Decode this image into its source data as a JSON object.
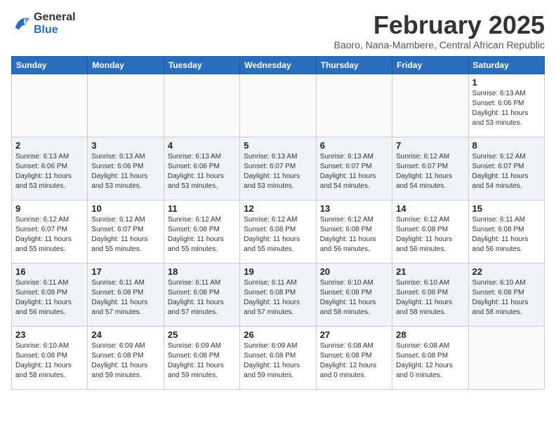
{
  "header": {
    "logo_line1": "General",
    "logo_line2": "Blue",
    "month_title": "February 2025",
    "subtitle": "Baoro, Nana-Mambere, Central African Republic"
  },
  "weekdays": [
    "Sunday",
    "Monday",
    "Tuesday",
    "Wednesday",
    "Thursday",
    "Friday",
    "Saturday"
  ],
  "weeks": [
    [
      {
        "day": "",
        "info": ""
      },
      {
        "day": "",
        "info": ""
      },
      {
        "day": "",
        "info": ""
      },
      {
        "day": "",
        "info": ""
      },
      {
        "day": "",
        "info": ""
      },
      {
        "day": "",
        "info": ""
      },
      {
        "day": "1",
        "info": "Sunrise: 6:13 AM\nSunset: 6:06 PM\nDaylight: 11 hours\nand 53 minutes."
      }
    ],
    [
      {
        "day": "2",
        "info": "Sunrise: 6:13 AM\nSunset: 6:06 PM\nDaylight: 11 hours\nand 53 minutes."
      },
      {
        "day": "3",
        "info": "Sunrise: 6:13 AM\nSunset: 6:06 PM\nDaylight: 11 hours\nand 53 minutes."
      },
      {
        "day": "4",
        "info": "Sunrise: 6:13 AM\nSunset: 6:06 PM\nDaylight: 11 hours\nand 53 minutes."
      },
      {
        "day": "5",
        "info": "Sunrise: 6:13 AM\nSunset: 6:07 PM\nDaylight: 11 hours\nand 53 minutes."
      },
      {
        "day": "6",
        "info": "Sunrise: 6:13 AM\nSunset: 6:07 PM\nDaylight: 11 hours\nand 54 minutes."
      },
      {
        "day": "7",
        "info": "Sunrise: 6:12 AM\nSunset: 6:07 PM\nDaylight: 11 hours\nand 54 minutes."
      },
      {
        "day": "8",
        "info": "Sunrise: 6:12 AM\nSunset: 6:07 PM\nDaylight: 11 hours\nand 54 minutes."
      }
    ],
    [
      {
        "day": "9",
        "info": "Sunrise: 6:12 AM\nSunset: 6:07 PM\nDaylight: 11 hours\nand 55 minutes."
      },
      {
        "day": "10",
        "info": "Sunrise: 6:12 AM\nSunset: 6:07 PM\nDaylight: 11 hours\nand 55 minutes."
      },
      {
        "day": "11",
        "info": "Sunrise: 6:12 AM\nSunset: 6:08 PM\nDaylight: 11 hours\nand 55 minutes."
      },
      {
        "day": "12",
        "info": "Sunrise: 6:12 AM\nSunset: 6:08 PM\nDaylight: 11 hours\nand 55 minutes."
      },
      {
        "day": "13",
        "info": "Sunrise: 6:12 AM\nSunset: 6:08 PM\nDaylight: 11 hours\nand 56 minutes."
      },
      {
        "day": "14",
        "info": "Sunrise: 6:12 AM\nSunset: 6:08 PM\nDaylight: 11 hours\nand 56 minutes."
      },
      {
        "day": "15",
        "info": "Sunrise: 6:11 AM\nSunset: 6:08 PM\nDaylight: 11 hours\nand 56 minutes."
      }
    ],
    [
      {
        "day": "16",
        "info": "Sunrise: 6:11 AM\nSunset: 6:08 PM\nDaylight: 11 hours\nand 56 minutes."
      },
      {
        "day": "17",
        "info": "Sunrise: 6:11 AM\nSunset: 6:08 PM\nDaylight: 11 hours\nand 57 minutes."
      },
      {
        "day": "18",
        "info": "Sunrise: 6:11 AM\nSunset: 6:08 PM\nDaylight: 11 hours\nand 57 minutes."
      },
      {
        "day": "19",
        "info": "Sunrise: 6:11 AM\nSunset: 6:08 PM\nDaylight: 11 hours\nand 57 minutes."
      },
      {
        "day": "20",
        "info": "Sunrise: 6:10 AM\nSunset: 6:08 PM\nDaylight: 11 hours\nand 58 minutes."
      },
      {
        "day": "21",
        "info": "Sunrise: 6:10 AM\nSunset: 6:08 PM\nDaylight: 11 hours\nand 58 minutes."
      },
      {
        "day": "22",
        "info": "Sunrise: 6:10 AM\nSunset: 6:08 PM\nDaylight: 11 hours\nand 58 minutes."
      }
    ],
    [
      {
        "day": "23",
        "info": "Sunrise: 6:10 AM\nSunset: 6:08 PM\nDaylight: 11 hours\nand 58 minutes."
      },
      {
        "day": "24",
        "info": "Sunrise: 6:09 AM\nSunset: 6:08 PM\nDaylight: 11 hours\nand 59 minutes."
      },
      {
        "day": "25",
        "info": "Sunrise: 6:09 AM\nSunset: 6:08 PM\nDaylight: 11 hours\nand 59 minutes."
      },
      {
        "day": "26",
        "info": "Sunrise: 6:09 AM\nSunset: 6:08 PM\nDaylight: 11 hours\nand 59 minutes."
      },
      {
        "day": "27",
        "info": "Sunrise: 6:08 AM\nSunset: 6:08 PM\nDaylight: 12 hours\nand 0 minutes."
      },
      {
        "day": "28",
        "info": "Sunrise: 6:08 AM\nSunset: 6:08 PM\nDaylight: 12 hours\nand 0 minutes."
      },
      {
        "day": "",
        "info": ""
      }
    ]
  ]
}
